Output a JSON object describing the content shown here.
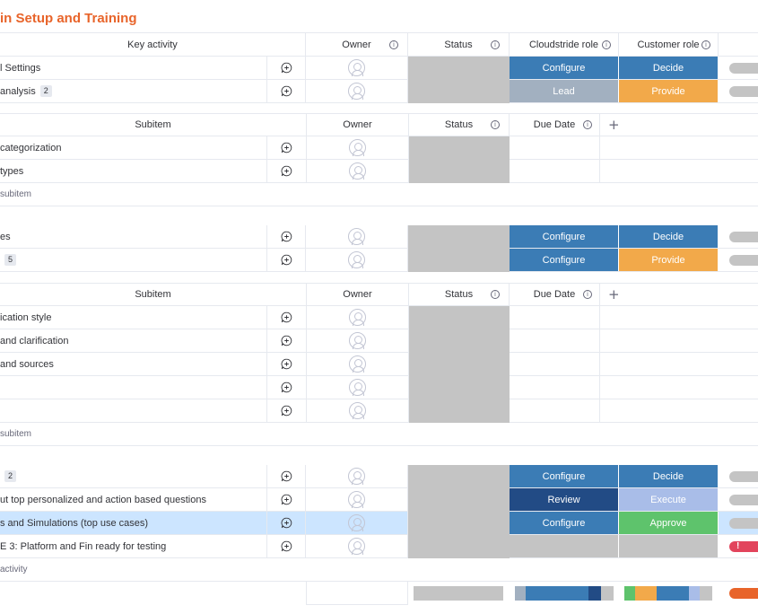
{
  "title": "in Setup and Training",
  "colors": {
    "blue": "#3b7cb5",
    "grayblue": "#a2b0c0",
    "orange": "#f2a94a",
    "darkblue": "#224b85",
    "lavender": "#a9bde8",
    "green": "#5ec36c",
    "status_gray": "#c4c4c4"
  },
  "main_header": {
    "name": "Key activity",
    "owner": "Owner",
    "status": "Status",
    "role1": "Cloudstride role",
    "role2": "Customer role"
  },
  "sub_header": {
    "name": "Subitem",
    "owner": "Owner",
    "status": "Status",
    "due": "Due Date",
    "plus": "+"
  },
  "rows": [
    {
      "name": "l Settings",
      "count": "",
      "role1": "Configure",
      "role2": "Decide",
      "c1": "#3b7cb5",
      "c2": "#3b7cb5"
    },
    {
      "name": "analysis",
      "count": "2",
      "role1": "Lead",
      "role2": "Provide",
      "c1": "#a2b0c0",
      "c2": "#f2a94a"
    },
    {
      "name": "es",
      "count": "",
      "role1": "Configure",
      "role2": "Decide",
      "c1": "#3b7cb5",
      "c2": "#3b7cb5"
    },
    {
      "name": "",
      "count": "5",
      "role1": "Configure",
      "role2": "Provide",
      "c1": "#3b7cb5",
      "c2": "#f2a94a"
    },
    {
      "name": "",
      "count": "2",
      "role1": "Configure",
      "role2": "Decide",
      "c1": "#3b7cb5",
      "c2": "#3b7cb5"
    },
    {
      "name": "ut top personalized and action based questions",
      "count": "",
      "role1": "Review",
      "role2": "Execute",
      "c1": "#224b85",
      "c2": "#a9bde8"
    },
    {
      "name": "s and Simulations (top use cases)",
      "count": "",
      "role1": "Configure",
      "role2": "Approve",
      "c1": "#3b7cb5",
      "c2": "#5ec36c"
    },
    {
      "name": "E 3: Platform and Fin ready for testing",
      "count": "",
      "role1": "",
      "role2": "",
      "c1": "#c4c4c4",
      "c2": "#c4c4c4"
    }
  ],
  "subitems_a": [
    "categorization",
    "types"
  ],
  "subitems_b": [
    "ication style",
    "and clarification",
    "and sources",
    "",
    ""
  ],
  "add_subitem": "subitem",
  "add_activity": "activity",
  "alert_mark": "!"
}
